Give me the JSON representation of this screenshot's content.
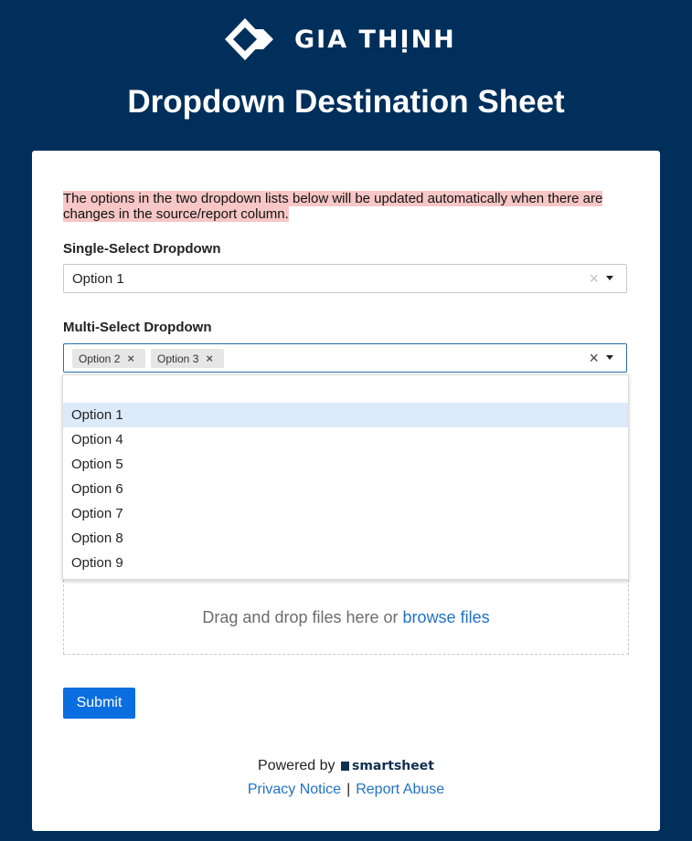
{
  "header": {
    "brand_name": "GIA THỊNH",
    "logo_icon": "gia-thinh-logo",
    "page_title": "Dropdown Destination Sheet"
  },
  "form": {
    "notice": "The options in the two dropdown lists below will be updated automatically when there are changes in the source/report column.",
    "single_select": {
      "label": "Single-Select Dropdown",
      "value": "Option 1",
      "clear_icon": "×"
    },
    "multi_select": {
      "label": "Multi-Select Dropdown",
      "selected_tags": [
        "Option 2",
        "Option 3"
      ],
      "tag_remove_icon": "×",
      "clear_icon": "×",
      "menu_open": true,
      "menu_options": [
        "Option 1",
        "Option 4",
        "Option 5",
        "Option 6",
        "Option 7",
        "Option 8",
        "Option 9"
      ],
      "highlighted_option": "Option 1"
    },
    "dropzone": {
      "text": "Drag and drop files here or",
      "link": "browse files"
    },
    "submit_label": "Submit"
  },
  "footer": {
    "powered_by": "Powered by",
    "brand": "smartsheet",
    "privacy_link": "Privacy Notice",
    "separator": "|",
    "abuse_link": "Report Abuse"
  },
  "colors": {
    "background": "#002f5b",
    "notice_highlight": "#f7c6c6",
    "accent": "#0a6ee0",
    "link": "#1f72c5",
    "menu_highlight": "#ddeafa"
  }
}
